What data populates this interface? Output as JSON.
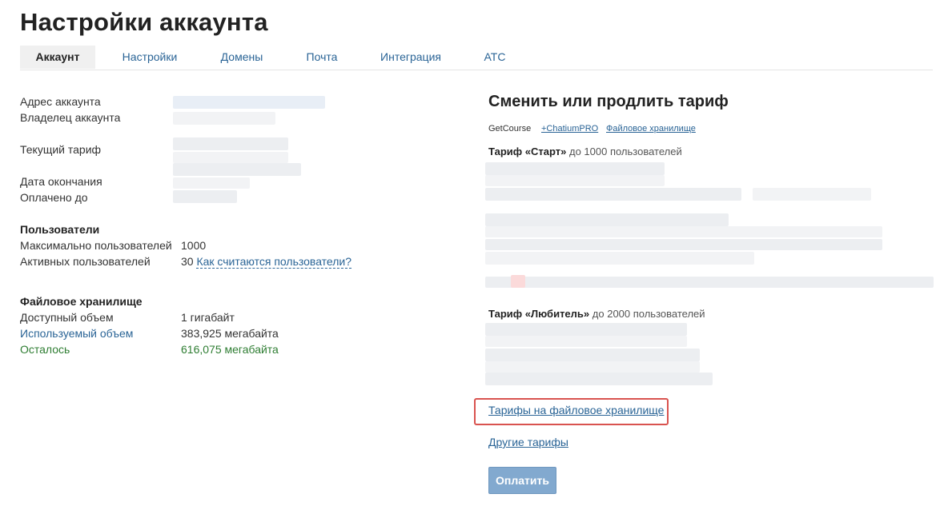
{
  "page": {
    "title": "Настройки аккаунта"
  },
  "tabs": [
    {
      "label": "Аккаунт",
      "active": true
    },
    {
      "label": "Настройки",
      "active": false
    },
    {
      "label": "Домены",
      "active": false
    },
    {
      "label": "Почта",
      "active": false
    },
    {
      "label": "Интеграция",
      "active": false
    },
    {
      "label": "АТС",
      "active": false
    }
  ],
  "account": {
    "address_label": "Адрес аккаунта",
    "owner_label": "Владелец аккаунта",
    "tariff_label": "Текущий тариф",
    "end_date_label": "Дата окончания",
    "paid_until_label": "Оплачено до"
  },
  "users": {
    "title": "Пользователи",
    "max_label": "Максимально пользователей",
    "max_value": "1000",
    "active_label": "Активных пользователей",
    "active_value": "30",
    "how_link": "Как считаются пользователи?"
  },
  "storage": {
    "title": "Файловое хранилище",
    "available_label": "Доступный объем",
    "available_value": "1 гигабайт",
    "used_label": "Используемый объем",
    "used_value": "383,925 мегабайта",
    "left_label": "Осталось",
    "left_value": "616,075 мегабайта"
  },
  "tariff_panel": {
    "title": "Сменить или продлить тариф",
    "product_current": "GetCourse",
    "product_links": [
      "+ChatiumPRO",
      "Файловое хранилище"
    ],
    "tariffs": [
      {
        "name": "Тариф «Старт»",
        "note": "до 1000 пользователей"
      },
      {
        "name": "Тариф «Любитель»",
        "note": "до 2000 пользователей"
      }
    ],
    "storage_tariffs_link": "Тарифы на файловое хранилище",
    "other_tariffs_link": "Другие тарифы",
    "pay_button": "Оплатить"
  },
  "colors": {
    "link": "#2a6496",
    "accent_green": "#2e7d32",
    "highlight": "#d9534f",
    "pay_button": "#82a9cf"
  }
}
